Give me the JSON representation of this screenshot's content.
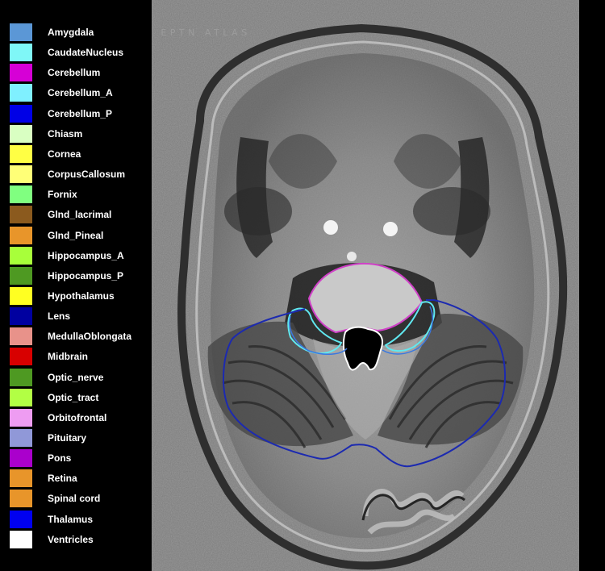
{
  "atlas_title": "EPTN ATLAS",
  "legend": [
    {
      "label": "Amygdala",
      "color": "#5b97d6"
    },
    {
      "label": "CaudateNucleus",
      "color": "#7ff7f7"
    },
    {
      "label": "Cerebellum",
      "color": "#d600d6"
    },
    {
      "label": "Cerebellum_A",
      "color": "#7ff0ff"
    },
    {
      "label": "Cerebellum_P",
      "color": "#0000e6"
    },
    {
      "label": "Chiasm",
      "color": "#d9ffc2"
    },
    {
      "label": "Cornea",
      "color": "#ffff44"
    },
    {
      "label": "CorpusCallosum",
      "color": "#ffff77"
    },
    {
      "label": "Fornix",
      "color": "#80ff80"
    },
    {
      "label": "Glnd_lacrimal",
      "color": "#8b5a1e"
    },
    {
      "label": "Glnd_Pineal",
      "color": "#e8952a"
    },
    {
      "label": "Hippocampus_A",
      "color": "#a8ff3a"
    },
    {
      "label": "Hippocampus_P",
      "color": "#4e9922"
    },
    {
      "label": "Hypothalamus",
      "color": "#ffff22"
    },
    {
      "label": "Lens",
      "color": "#0000a0"
    },
    {
      "label": "MedullaOblongata",
      "color": "#e8928a"
    },
    {
      "label": "Midbrain",
      "color": "#d80000"
    },
    {
      "label": "Optic_nerve",
      "color": "#4e9922"
    },
    {
      "label": "Optic_tract",
      "color": "#b2ff44"
    },
    {
      "label": "Orbitofrontal",
      "color": "#ee9cf2"
    },
    {
      "label": "Pituitary",
      "color": "#9098d8"
    },
    {
      "label": "Pons",
      "color": "#aa00cc"
    },
    {
      "label": "Retina",
      "color": "#e8952a"
    },
    {
      "label": "Spinal cord",
      "color": "#e8952a"
    },
    {
      "label": "Thalamus",
      "color": "#0000f0"
    },
    {
      "label": "Ventricles",
      "color": "#ffffff"
    }
  ],
  "contour_colors": {
    "pons": "#d040c8",
    "cerebellum_a": "#60e8f0",
    "cerebellum_p": "#1c2ab0",
    "inner_blue": "#3a78e0"
  }
}
